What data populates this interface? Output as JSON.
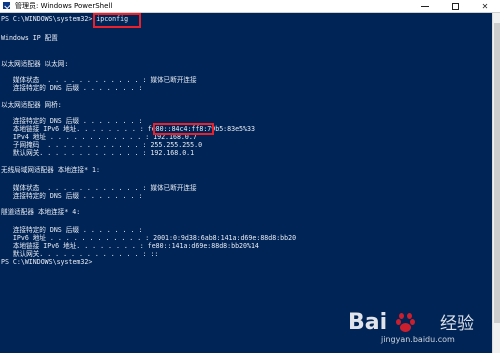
{
  "window": {
    "title": "管理员: Windows PowerShell"
  },
  "console": {
    "lines": [
      "PS C:\\WINDOWS\\system32> ipconfig",
      "",
      "Windows IP 配置",
      "",
      "",
      "以太网适配器 以太网:",
      "",
      "   媒体状态  . . . . . . . . . . . . : 媒体已断开连接",
      "   连接特定的 DNS 后缀 . . . . . . . :",
      "",
      "以太网适配器 网桥:",
      "",
      "   连接特定的 DNS 后缀 . . . . . . . :",
      "   本地链接 IPv6 地址. . . . . . . . : fe80::84c4:ff8:79b5:83e5%33",
      "   IPv4 地址 . . . . . . . . . . . . : 192.168.0.7",
      "   子网掩码  . . . . . . . . . . . . : 255.255.255.0",
      "   默认网关. . . . . . . . . . . . . : 192.168.0.1",
      "",
      "无线局域网适配器 本地连接* 1:",
      "",
      "   媒体状态  . . . . . . . . . . . . : 媒体已断开连接",
      "   连接特定的 DNS 后缀 . . . . . . . :",
      "",
      "隧道适配器 本地连接* 4:",
      "",
      "   连接特定的 DNS 后缀 . . . . . . . :",
      "   IPv6 地址 . . . . . . . . . . . . : 2001:0:9d38:6ab8:141a:d69e:88d8:bb20",
      "   本地链接 IPv6 地址. . . . . . . . : fe80::141a:d69e:88d8:bb20%14",
      "   默认网关. . . . . . . . . . . . . : ::",
      "PS C:\\WINDOWS\\system32>"
    ]
  },
  "watermark": {
    "logo": "Bai",
    "suffix": "经验",
    "url": "jingyan.baidu.com"
  },
  "colors": {
    "console_bg": "#012456",
    "text": "#e9eef6",
    "highlight": "#e8212d"
  }
}
